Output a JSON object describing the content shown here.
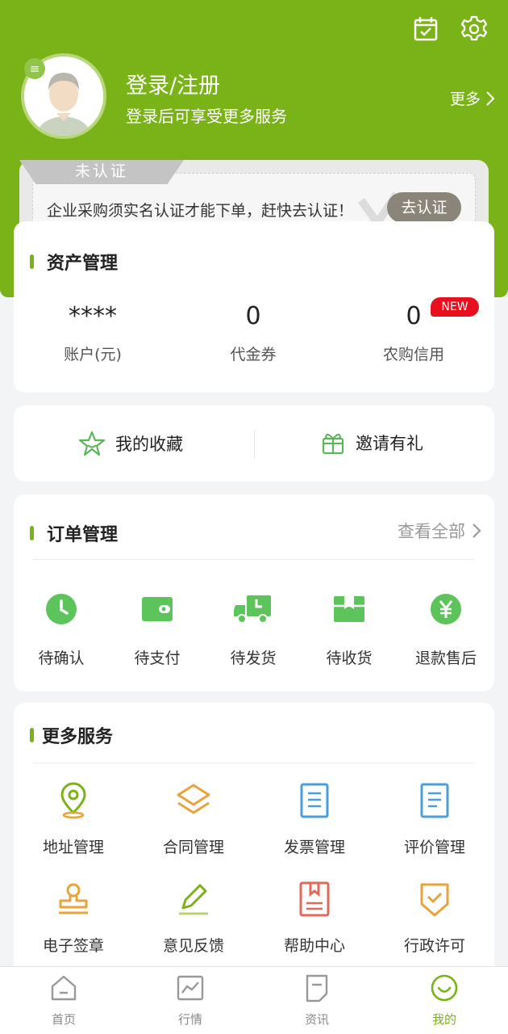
{
  "header": {
    "login_title": "登录/注册",
    "login_subtitle": "登录后可享受更多服务",
    "more_label": "更多",
    "icons": [
      "calendar-check-icon",
      "settings-icon",
      "menu-icon"
    ]
  },
  "auth": {
    "badge": "未认证",
    "message": "企业采购须实名认证才能下单，赶快去认证！",
    "button": "去认证"
  },
  "assets": {
    "title": "资产管理",
    "items": [
      {
        "value": "****",
        "label": "账户(元)"
      },
      {
        "value": "0",
        "label": "代金券"
      },
      {
        "value": "0",
        "label": "农购信用",
        "badge": "NEW"
      }
    ]
  },
  "quick_links": {
    "favorites": "我的收藏",
    "invite": "邀请有礼"
  },
  "orders": {
    "title": "订单管理",
    "view_all": "查看全部",
    "items": [
      {
        "label": "待确认",
        "icon": "clock-icon"
      },
      {
        "label": "待支付",
        "icon": "wallet-icon"
      },
      {
        "label": "待发货",
        "icon": "truck-icon"
      },
      {
        "label": "待收货",
        "icon": "package-icon"
      },
      {
        "label": "退款售后",
        "icon": "yuan-icon"
      }
    ]
  },
  "services": {
    "title": "更多服务",
    "items": [
      {
        "label": "地址管理",
        "icon": "location-pin-icon"
      },
      {
        "label": "合同管理",
        "icon": "layers-icon"
      },
      {
        "label": "发票管理",
        "icon": "invoice-icon"
      },
      {
        "label": "评价管理",
        "icon": "review-icon"
      },
      {
        "label": "电子签章",
        "icon": "stamp-icon"
      },
      {
        "label": "意见反馈",
        "icon": "pencil-icon"
      },
      {
        "label": "帮助中心",
        "icon": "help-book-icon"
      },
      {
        "label": "行政许可",
        "icon": "shield-check-icon"
      }
    ]
  },
  "tabbar": {
    "items": [
      {
        "label": "首页",
        "icon": "home-icon"
      },
      {
        "label": "行情",
        "icon": "chart-icon"
      },
      {
        "label": "资讯",
        "icon": "news-icon"
      },
      {
        "label": "我的",
        "icon": "profile-smile-icon",
        "active": true
      }
    ]
  },
  "colors": {
    "brand_green": "#7ab317",
    "new_badge_red": "#e8101e",
    "order_icon_green": "#5cc45a",
    "service_icon_blue": "#4a9ee0",
    "service_icon_orange": "#e8a33a",
    "service_icon_red": "#e06a5a"
  }
}
